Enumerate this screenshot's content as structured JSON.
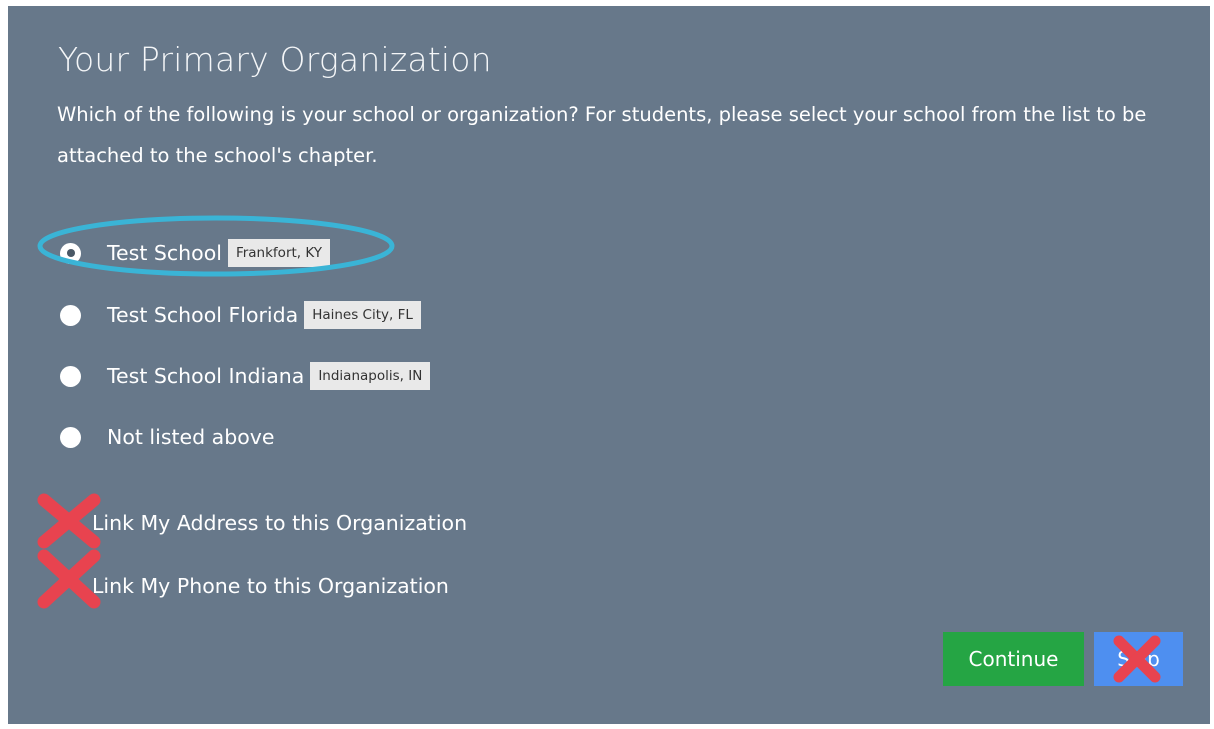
{
  "heading": "Your Primary Organization",
  "description": "Which of the following is your school or organization? For students, please select your school from the list to be attached to the school's chapter.",
  "options": [
    {
      "label": "Test School",
      "location": "Frankfort, KY",
      "selected": true
    },
    {
      "label": "Test School Florida",
      "location": "Haines City, FL",
      "selected": false
    },
    {
      "label": "Test School Indiana",
      "location": "Indianapolis, IN",
      "selected": false
    },
    {
      "label": "Not listed above",
      "location": "",
      "selected": false
    }
  ],
  "links": {
    "address": "Link My Address to this Organization",
    "phone": "Link My Phone to this Organization"
  },
  "buttons": {
    "continue": "Continue",
    "skip": "Skip"
  },
  "colors": {
    "panel": "#67788a",
    "continue": "#25a544",
    "skip": "#4e8ff0",
    "ring": "#3ab4d6",
    "x_mark": "#e8434f"
  },
  "icons": {
    "annotation_ring": "ellipse-highlight",
    "annotation_x": "red-x-mark-icon"
  }
}
